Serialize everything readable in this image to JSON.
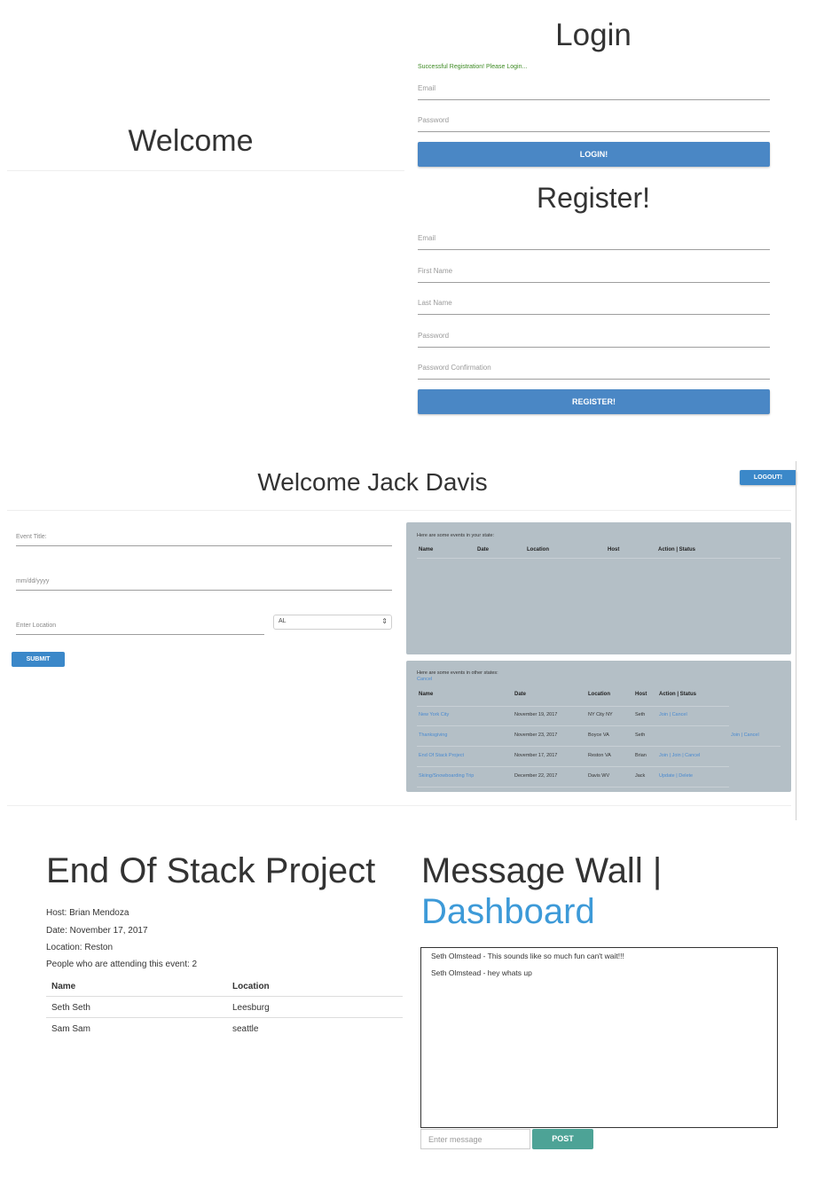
{
  "login_page": {
    "welcome_title": "Welcome",
    "login_title": "Login",
    "success_message": "Successful Registration! Please Login...",
    "login_email_placeholder": "Email",
    "login_password_placeholder": "Password",
    "login_button": "LOGIN!",
    "register_title": "Register!",
    "register_fields": [
      "Email",
      "First Name",
      "Last Name",
      "Password",
      "Password Confirmation"
    ],
    "register_button": "REGISTER!",
    "button_color": "#4a87c5"
  },
  "dashboard": {
    "welcome_title": "Welcome Jack Davis",
    "logout_button": "LOGOUT!",
    "event_title_placeholder": "Event Title:",
    "date_placeholder": "mm/dd/yyyy",
    "location_placeholder": "Enter Location",
    "state_selected": "AL",
    "submit_button": "SUBMIT",
    "state_events": {
      "note": "Here are some events in your state:",
      "headers": [
        "Name",
        "Date",
        "Location",
        "Host",
        "Action | Status"
      ]
    },
    "other_events": {
      "note": "Here are some events in other states:",
      "cancel_link": "Cancel",
      "headers": [
        "Name",
        "Date",
        "Location",
        "Host",
        "Action | Status"
      ],
      "rows": [
        {
          "name": "New York City",
          "date": "November 19, 2017",
          "location": "NY City NY",
          "host": "Seth",
          "action": "Join | Cancel",
          "extra": ""
        },
        {
          "name": "Thanksgiving",
          "date": "November 23, 2017",
          "location": "Boyce VA",
          "host": "Seth",
          "action": "",
          "extra": "Join | Cancel"
        },
        {
          "name": "End Of Stack Project",
          "date": "November 17, 2017",
          "location": "Reston VA",
          "host": "Brian",
          "action": "Join | Join | Cancel",
          "extra": ""
        },
        {
          "name": "Skiing/Snowboarding Trip",
          "date": "December 22, 2017",
          "location": "Davis WV",
          "host": "Jack",
          "action": "Update | Delete",
          "extra": ""
        }
      ]
    },
    "panel_color": "#b4bfc6",
    "link_color": "#4a8ad0"
  },
  "event_page": {
    "title": "End Of Stack Project",
    "host": "Host: Brian Mendoza",
    "date": "Date: November 17, 2017",
    "location": "Location: Reston",
    "attending": "People who are attending this event: 2",
    "headers": [
      "Name",
      "Location"
    ],
    "attendees": [
      {
        "name": "Seth Seth",
        "location": "Leesburg"
      },
      {
        "name": "Sam Sam",
        "location": "seattle"
      }
    ],
    "wall_title": "Message Wall |",
    "dashboard_link": "Dashboard",
    "messages": [
      "Seth Olmstead - This sounds like so much fun can't wait!!!",
      "Seth Olmstead - hey whats up"
    ],
    "message_placeholder": "Enter message",
    "post_button": "POST",
    "post_color": "#4da396"
  }
}
